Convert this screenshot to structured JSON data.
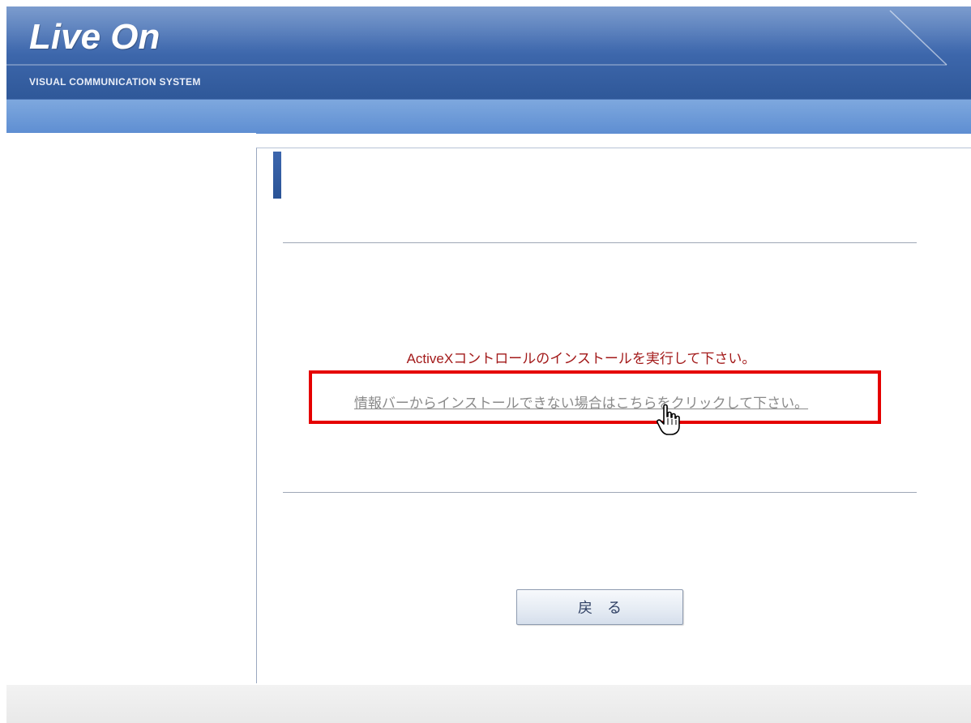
{
  "header": {
    "logo_text": "Live On",
    "tagline": "VISUAL COMMUNICATION SYSTEM"
  },
  "main": {
    "instruction": "ActiveXコントロールのインストールを実行して下さい。",
    "link_text": "情報バーからインストールできない場合はこちらをクリックして下さい。",
    "back_button": "戻る"
  },
  "colors": {
    "header_blue": "#3f69ae",
    "instruction_red": "#a31a1a",
    "highlight_red": "#e50000",
    "link_gray": "#8a8a8a"
  },
  "icons": [
    "hand-pointer-cursor-icon"
  ]
}
